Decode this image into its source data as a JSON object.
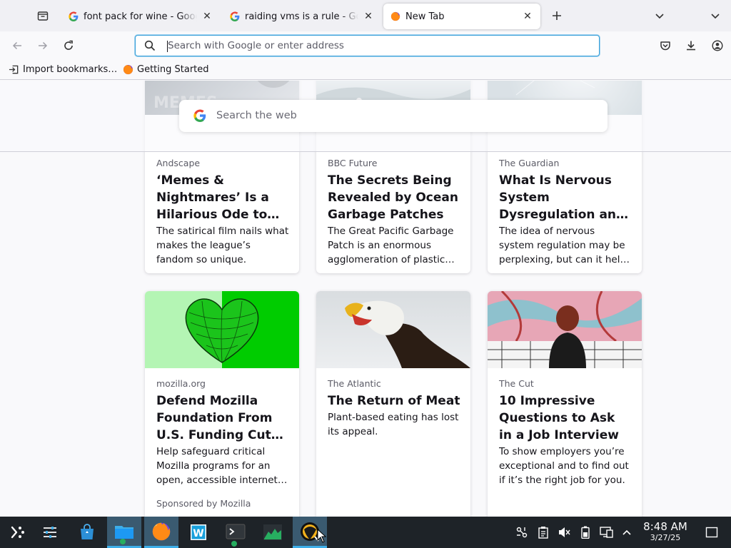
{
  "tabs": [
    {
      "title": "font pack for wine - Google Search",
      "active": false,
      "icon": "google-g-icon"
    },
    {
      "title": "raiding vms is a rule - Google Search",
      "active": false,
      "icon": "google-g-icon"
    },
    {
      "title": "New Tab",
      "active": true,
      "icon": "firefox-icon"
    }
  ],
  "urlbar": {
    "placeholder": "Search with Google or enter address",
    "value": ""
  },
  "bookmarks": [
    {
      "label": "Import bookmarks…",
      "icon": "import-icon"
    },
    {
      "label": "Getting Started",
      "icon": "firefox-icon"
    }
  ],
  "websearch": {
    "placeholder": "Search the web"
  },
  "stories_row1": [
    {
      "source": "Andscape",
      "title": "‘Memes & Nightmares’ Is a Hilarious Ode to NBA Fans",
      "excerpt": "The satirical film nails what makes the league’s fandom so unique."
    },
    {
      "source": "BBC Future",
      "title": "The Secrets Being Revealed by Ocean Garbage Patches",
      "excerpt": "The Great Pacific Garbage Patch is an enormous agglomeration of plastic debris."
    },
    {
      "source": "The Guardian",
      "title": "What Is Nervous System Dysregulation and How Can It Be Treated?",
      "excerpt": "The idea of nervous system regulation may be perplexing, but can it help us?"
    }
  ],
  "stories_row2": [
    {
      "source": "mozilla.org",
      "title": "Defend Mozilla Foundation From U.S. Funding Cuts – Donate",
      "excerpt": "Help safeguard critical Mozilla programs for an open, accessible internet. Donate today.",
      "sponsor": "Sponsored by Mozilla"
    },
    {
      "source": "The Atlantic",
      "title": "The Return of Meat",
      "excerpt": "Plant-based eating has lost its appeal."
    },
    {
      "source": "The Cut",
      "title": "10 Impressive Questions to Ask in a Job Interview",
      "excerpt": "To show employers you’re exceptional and to find out if it’s the right job for you."
    }
  ],
  "taskbar": {
    "apps": [
      "application-launcher-icon",
      "system-settings-icon",
      "discover-store-icon",
      "dolphin-files-icon",
      "firefox-icon",
      "libreoffice-writer-icon",
      "konsole-terminal-icon",
      "system-monitor-icon",
      "steam-icon"
    ],
    "clock_time": "8:48 AM",
    "clock_date": "3/27/25"
  },
  "colors": {
    "accent": "#3daee9",
    "taskbar": "#1e2328",
    "mozilla_green": "#00cc00"
  }
}
